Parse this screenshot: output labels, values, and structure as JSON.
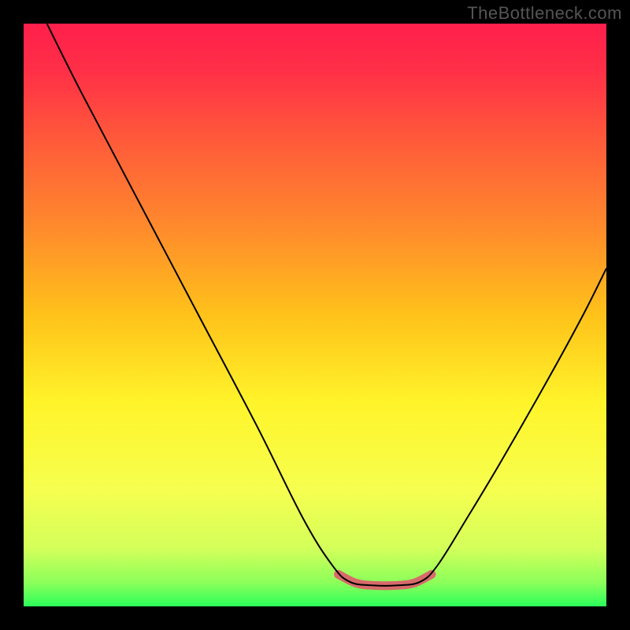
{
  "watermark": "TheBottleneck.com",
  "chart_data": {
    "type": "line",
    "title": "",
    "xlabel": "",
    "ylabel": "",
    "xlim": [
      0,
      100
    ],
    "ylim": [
      0,
      100
    ],
    "gradient_stops": [
      {
        "offset": 0.0,
        "color": "#ff1f4b"
      },
      {
        "offset": 0.08,
        "color": "#ff2f47"
      },
      {
        "offset": 0.2,
        "color": "#ff5a3a"
      },
      {
        "offset": 0.35,
        "color": "#ff8a2c"
      },
      {
        "offset": 0.5,
        "color": "#ffc21a"
      },
      {
        "offset": 0.65,
        "color": "#fff42a"
      },
      {
        "offset": 0.8,
        "color": "#f6ff4f"
      },
      {
        "offset": 0.9,
        "color": "#d4ff5a"
      },
      {
        "offset": 0.96,
        "color": "#8bff5a"
      },
      {
        "offset": 1.0,
        "color": "#2bff5a"
      }
    ],
    "series": [
      {
        "name": "curve",
        "stroke": "#000000",
        "stroke_width": 2,
        "points": [
          {
            "x": 4,
            "y": 100
          },
          {
            "x": 10,
            "y": 88
          },
          {
            "x": 20,
            "y": 69
          },
          {
            "x": 30,
            "y": 50
          },
          {
            "x": 40,
            "y": 31
          },
          {
            "x": 48,
            "y": 15
          },
          {
            "x": 53,
            "y": 7
          },
          {
            "x": 56,
            "y": 4.2
          },
          {
            "x": 60,
            "y": 3.6
          },
          {
            "x": 64,
            "y": 3.6
          },
          {
            "x": 68,
            "y": 4.2
          },
          {
            "x": 71,
            "y": 7
          },
          {
            "x": 76,
            "y": 15
          },
          {
            "x": 82,
            "y": 25
          },
          {
            "x": 90,
            "y": 39
          },
          {
            "x": 96,
            "y": 50
          },
          {
            "x": 100,
            "y": 58
          }
        ]
      },
      {
        "name": "flat-highlight",
        "stroke": "#d86a6a",
        "stroke_width": 11,
        "linecap": "round",
        "points": [
          {
            "x": 54,
            "y": 5.5
          },
          {
            "x": 57,
            "y": 4.0
          },
          {
            "x": 60,
            "y": 3.6
          },
          {
            "x": 64,
            "y": 3.6
          },
          {
            "x": 67,
            "y": 4.0
          },
          {
            "x": 70,
            "y": 5.5
          }
        ]
      }
    ]
  }
}
